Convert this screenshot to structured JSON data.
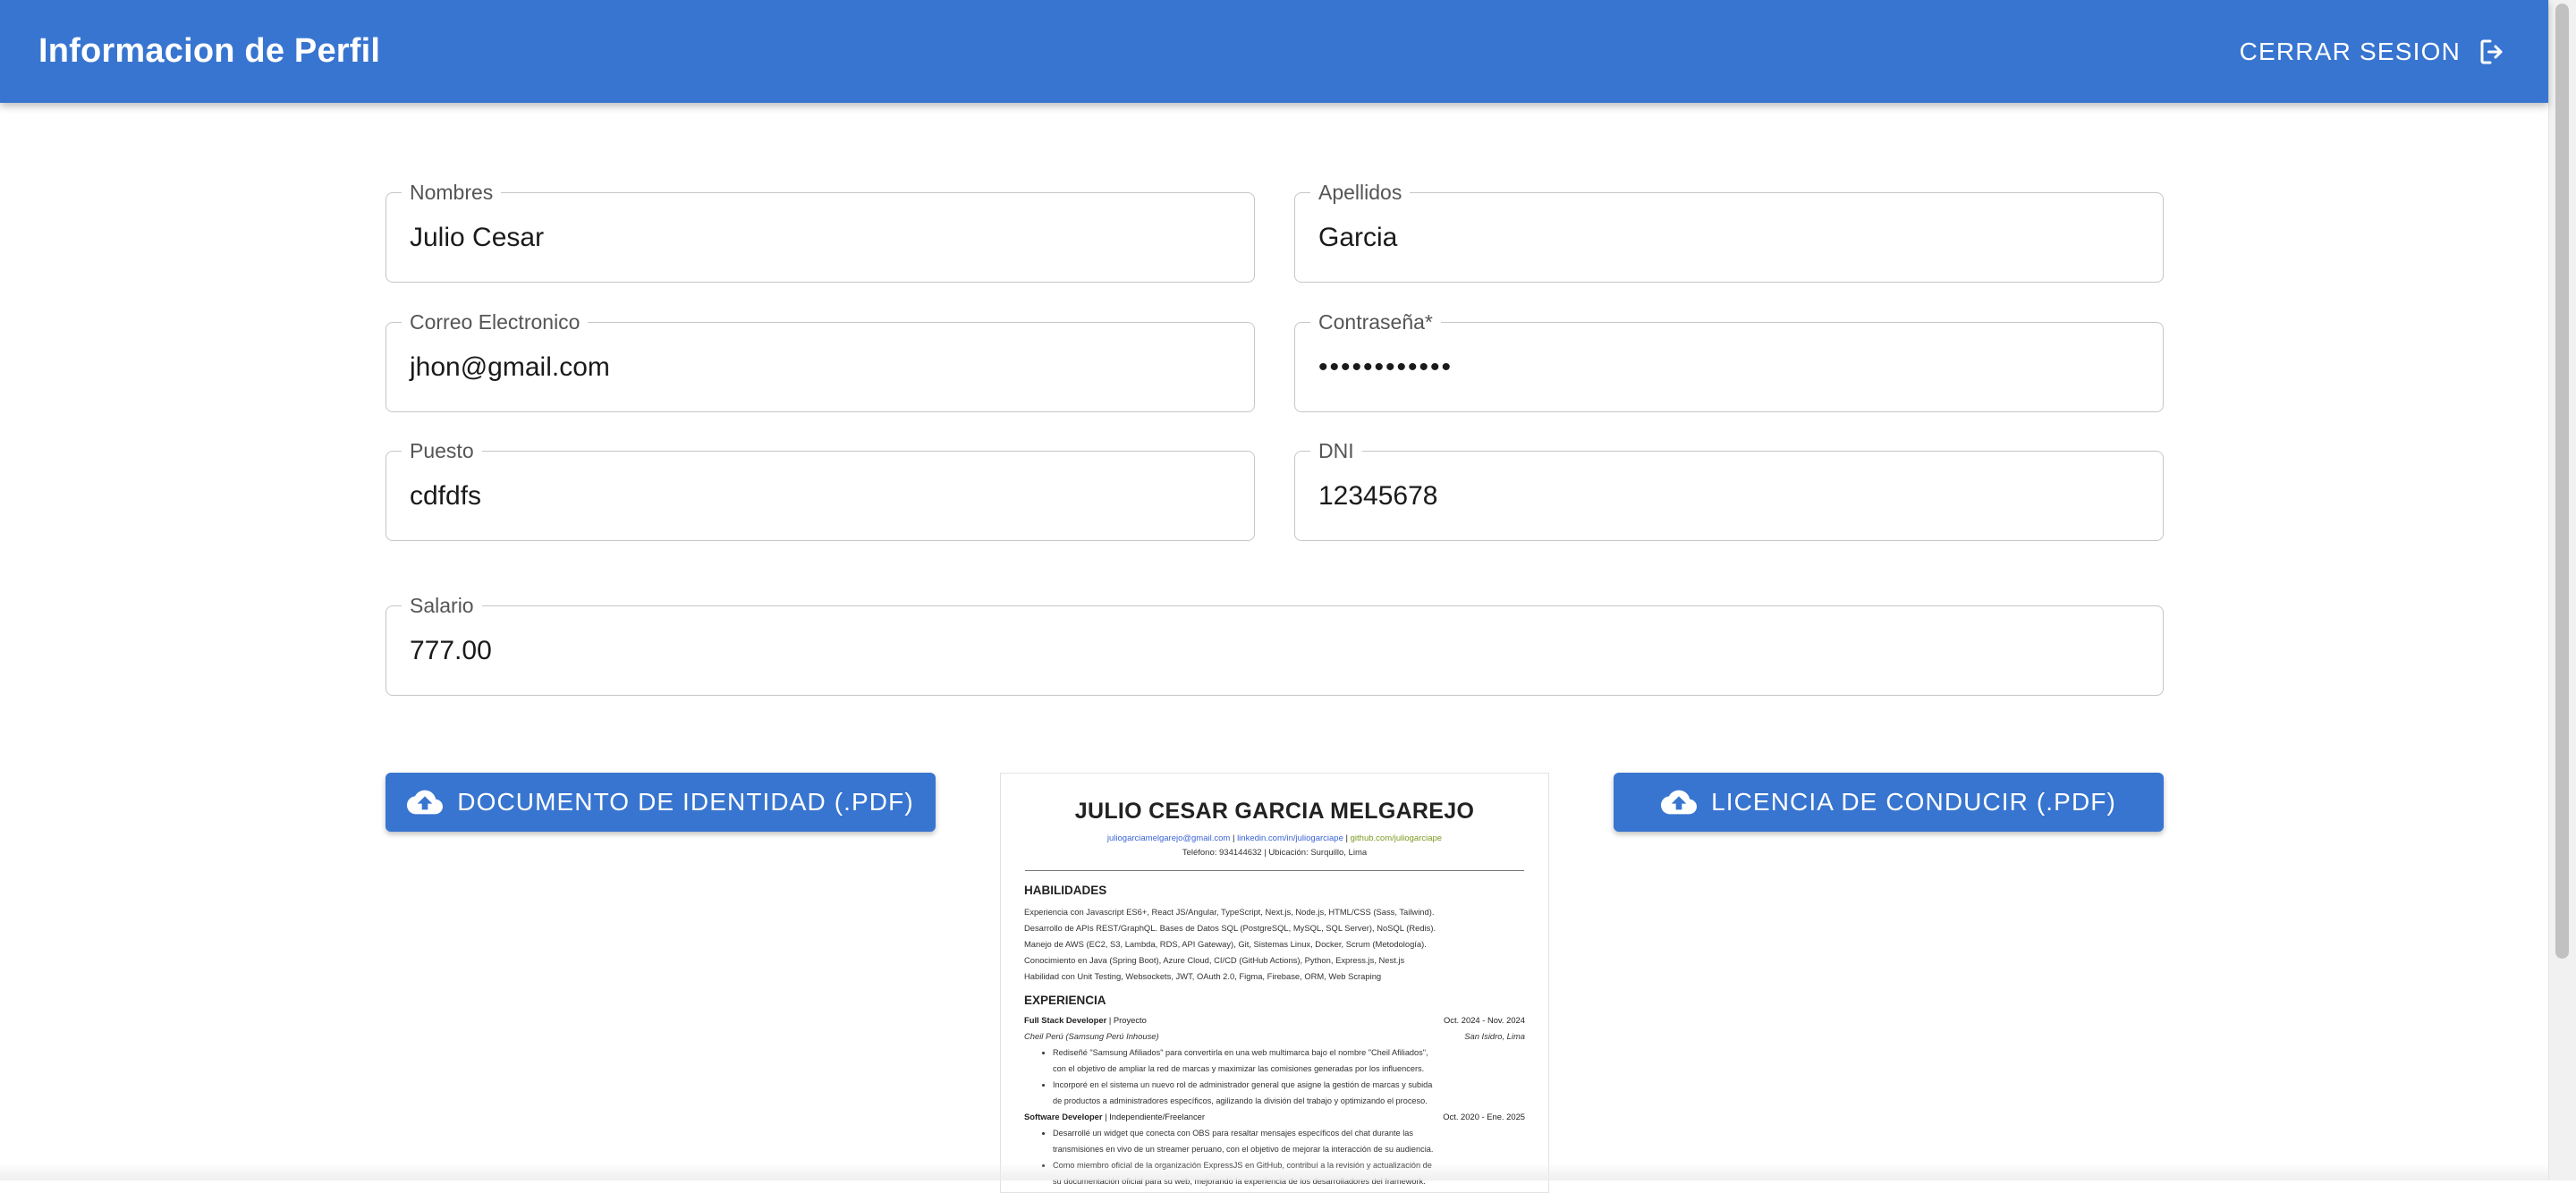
{
  "header": {
    "title": "Informacion de Perfil",
    "logout_label": "CERRAR SESION",
    "logout_icon": "logout-icon",
    "bg_color": "#3875d0"
  },
  "form": {
    "nombres": {
      "label": "Nombres",
      "value": "Julio Cesar"
    },
    "apellidos": {
      "label": "Apellidos",
      "value": "Garcia"
    },
    "correo": {
      "label": "Correo Electronico",
      "value": "jhon@gmail.com"
    },
    "password": {
      "label": "Contraseña",
      "required_mark": "*",
      "value": "••••••••••••"
    },
    "puesto": {
      "label": "Puesto",
      "value": "cdfdfs"
    },
    "dni": {
      "label": "DNI",
      "value": "12345678"
    },
    "salario": {
      "label": "Salario",
      "value": "777.00"
    }
  },
  "uploads": {
    "identity_label": "DOCUMENTO DE IDENTIDAD (.PDF)",
    "license_label": "LICENCIA DE CONDUCIR (.PDF)",
    "icon": "cloud-upload-icon"
  },
  "preview": {
    "name": "JULIO CESAR GARCIA MELGAREJO",
    "link_email": "juliogarciamelgarejo@gmail.com",
    "link_linkedin": "linkedin.com/in/juliogarciape",
    "link_github": "github.com/juliogarciape",
    "link_sep": " | ",
    "contact": "Teléfono: 934144632 | Ubicación: Surquillo, Lima",
    "skills_heading": "HABILIDADES",
    "skills": [
      "Experiencia con Javascript ES6+, React JS/Angular, TypeScript, Next.js, Node.js, HTML/CSS (Sass, Tailwind).",
      "Desarrollo de APIs REST/GraphQL. Bases de Datos SQL (PostgreSQL, MySQL, SQL Server), NoSQL (Redis).",
      "Manejo de AWS (EC2, S3, Lambda, RDS, API Gateway), Git, Sistemas Linux, Docker, Scrum (Metodología).",
      "Conocimiento en Java (Spring Boot), Azure Cloud, CI/CD (GitHub Actions), Python, Express.js, Nest.js",
      "Habilidad con Unit Testing, Websockets, JWT, OAuth 2.0, Figma, Firebase, ORM, Web Scraping"
    ],
    "exp_heading": "EXPERIENCIA",
    "job1_role": "Full Stack Developer",
    "job1_type": " | Proyecto",
    "job1_dates": "Oct. 2024 - Nov. 2024",
    "job1_company": "Cheil Perú (Samsung Perú Inhouse)",
    "job1_location": "San Isidro, Lima",
    "job1_bullets": [
      "Rediseñé \"Samsung Afiliados\" para convertirla en una web multimarca bajo el nombre \"Cheil Afiliados\",",
      "con el objetivo de ampliar la red de marcas y maximizar las comisiones generadas por los influencers.",
      "Incorporé en el sistema un nuevo rol de administrador general que asigne la gestión de marcas y subida",
      "de productos a administradores específicos, agilizando la división del trabajo y optimizando el proceso."
    ],
    "job2_role": "Software Developer",
    "job2_type": " | Independiente/Freelancer",
    "job2_dates": "Oct. 2020 - Ene. 2025",
    "job2_bullets": [
      "Desarrollé un widget que conecta con OBS para resaltar mensajes específicos del chat durante las",
      "transmisiones en vivo de un streamer peruano, con el objetivo de mejorar la interacción de su audiencia.",
      "Como miembro oficial de la organización ExpressJS en GitHub, contribuí a la revisión y actualización de",
      "su documentación oficial para su web, mejorando la experiencia de los desarrolladores del framework."
    ]
  }
}
